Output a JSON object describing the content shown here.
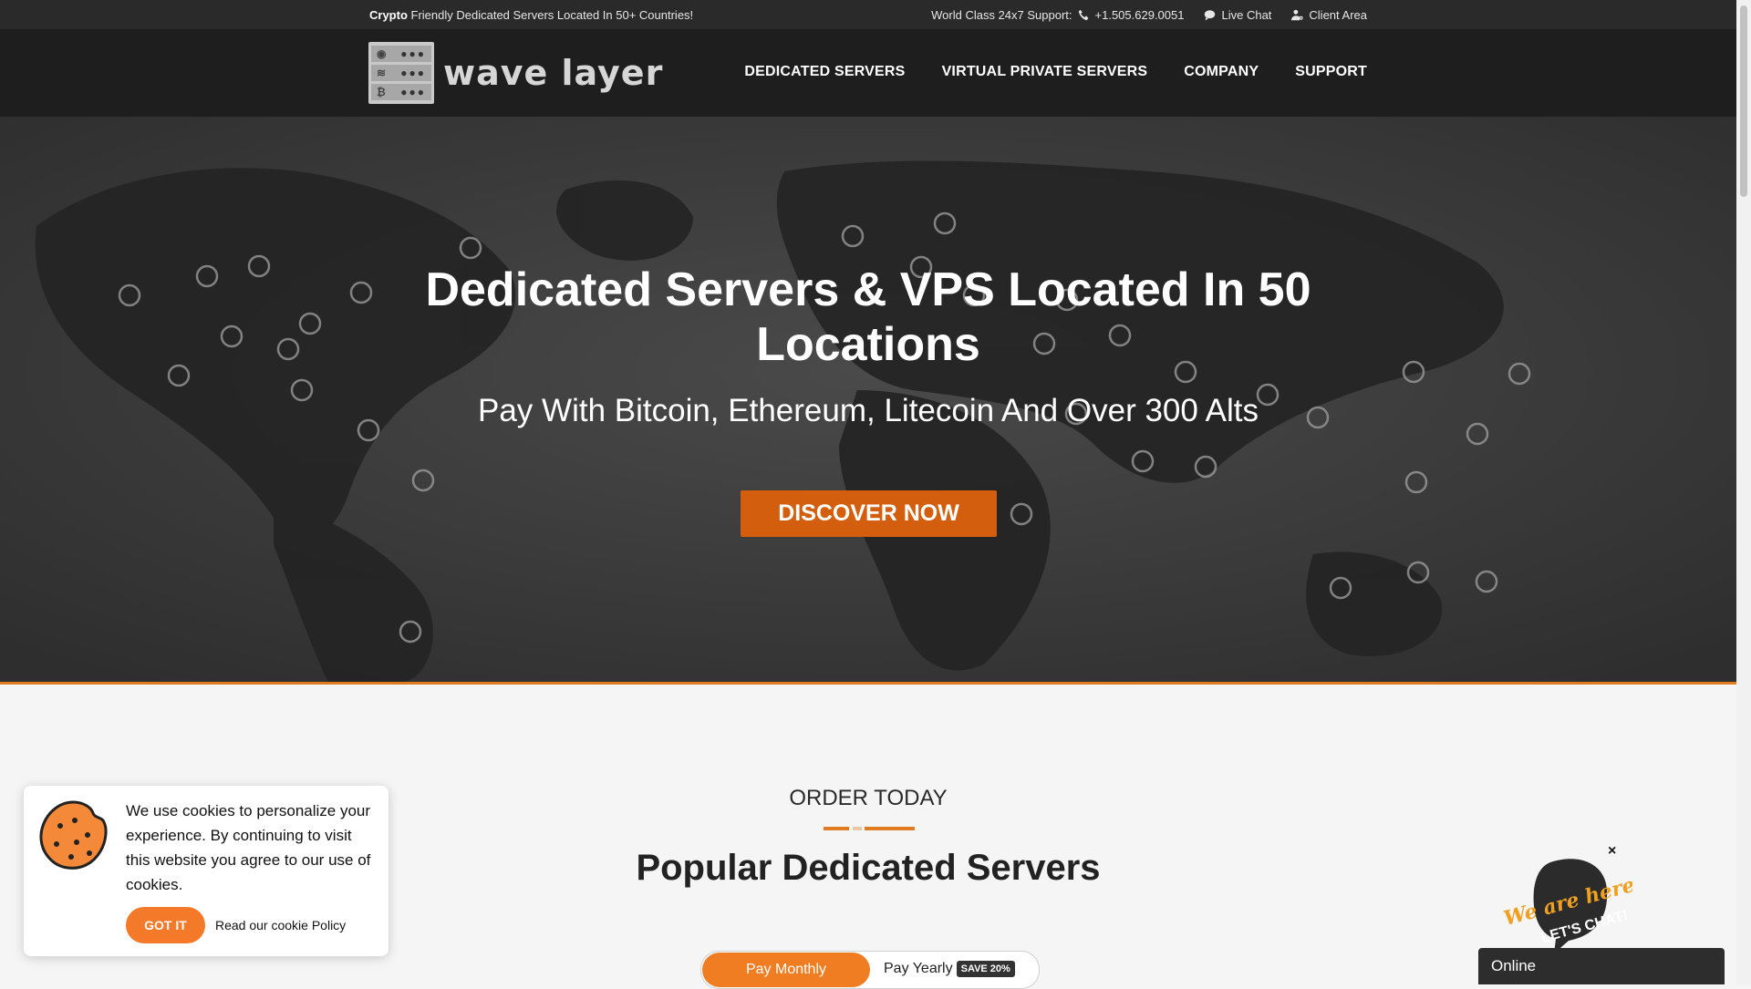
{
  "topbar": {
    "promo_bold": "Crypto",
    "promo_rest": "Friendly Dedicated Servers Located In 50+ Countries!",
    "support_label": "World Class 24x7 Support:",
    "phone": "+1.505.629.0051",
    "live_chat": "Live Chat",
    "client_area": "Client Area"
  },
  "header": {
    "logo_text": "wave layer",
    "nav": [
      "DEDICATED SERVERS",
      "VIRTUAL PRIVATE SERVERS",
      "COMPANY",
      "SUPPORT"
    ]
  },
  "hero": {
    "title": "Dedicated Servers & VPS Located In 50 Locations",
    "subtitle": "Pay With Bitcoin, Ethereum, Litecoin And Over 300 Alts",
    "cta": "DISCOVER NOW"
  },
  "order": {
    "eyebrow": "ORDER TODAY",
    "heading": "Popular Dedicated Servers",
    "toggle_monthly": "Pay Monthly",
    "toggle_yearly": "Pay Yearly",
    "save_badge": "SAVE 20%"
  },
  "cookie": {
    "message": "We use cookies to personalize your experience. By continuing to visit this website you agree to our use of cookies.",
    "button": "GOT IT",
    "policy_link": "Read our cookie Policy"
  },
  "chat": {
    "close": "×",
    "bubble_line1": "We are here!",
    "bubble_line2": "LET'S CHAT!",
    "status": "Online"
  },
  "colors": {
    "accent": "#e07b21",
    "cta": "#d35f0e",
    "topbar": "#2a2a2a",
    "header": "#1e1e1e"
  }
}
